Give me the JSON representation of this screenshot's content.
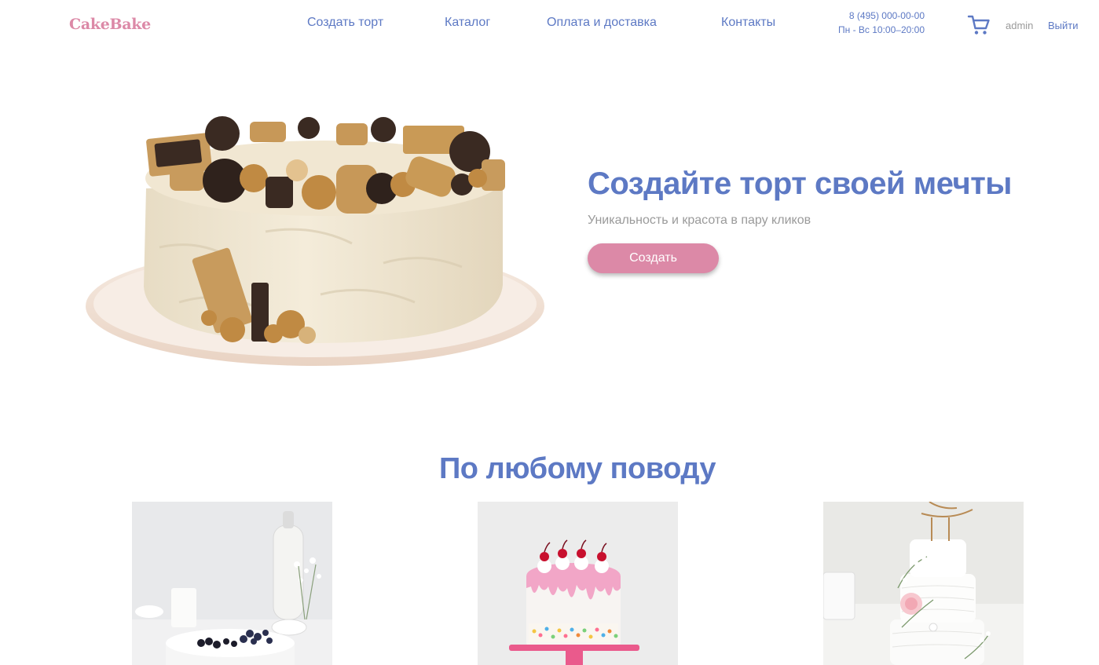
{
  "header": {
    "logo": "CakeBake",
    "nav": [
      {
        "label": "Создать торт"
      },
      {
        "label": "Каталог"
      },
      {
        "label": "Оплата и доставка"
      },
      {
        "label": "Контакты"
      }
    ],
    "phone": "8 (495) 000-00-00",
    "hours": "Пн - Вс 10:00–20:00",
    "cart_icon": "shopping-cart-icon",
    "user": "admin",
    "logout": "Выйти"
  },
  "hero": {
    "title": "Создайте торт своей мечты",
    "subtitle": "Уникальность и красота в пару кликов",
    "button": "Создать"
  },
  "occasions": {
    "title": "По любому поводу",
    "cards": [
      {
        "subject": "white cake with berries"
      },
      {
        "subject": "pink drip cake with cherries"
      },
      {
        "subject": "white wedding cake with flowers"
      }
    ]
  },
  "colors": {
    "accent_blue": "#5d79c4",
    "brand_pink": "#dc89a7",
    "muted_text": "#9a9a9a"
  }
}
